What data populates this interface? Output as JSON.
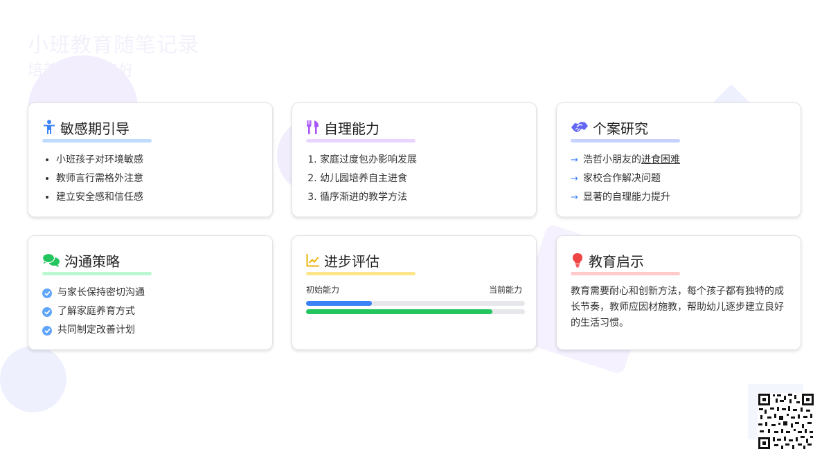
{
  "page": {
    "title": "小班教育随笔记录",
    "subtitle": "培养孩子的良好习惯"
  },
  "cards": [
    {
      "title": "敏感期引导",
      "icon": "child-icon",
      "accent": "#3b82f6",
      "underline": "#bfdbfe",
      "items": [
        "小班孩子对环境敏感",
        "教师言行需格外注意",
        "建立安全感和信任感"
      ]
    },
    {
      "title": "自理能力",
      "icon": "utensils-icon",
      "accent": "#a855f7",
      "underline": "#e9d5ff",
      "items": [
        "家庭过度包办影响发展",
        "幼儿园培养自主进食",
        "循序渐进的教学方法"
      ]
    },
    {
      "title": "个案研究",
      "icon": "handshake-icon",
      "accent": "#6366f1",
      "underline": "#c7d2fe",
      "items": [
        {
          "prefix": "浩哲小朋友的",
          "emphasis": "进食困难"
        },
        "家校合作解决问题",
        "显著的自理能力提升"
      ]
    },
    {
      "title": "沟通策略",
      "icon": "chat-bubbles-icon",
      "accent": "#22c55e",
      "underline": "#bbf7d0",
      "items": [
        "与家长保持密切沟通",
        "了解家庭养育方式",
        "共同制定改善计划"
      ]
    },
    {
      "title": "进步评估",
      "icon": "line-chart-icon",
      "accent": "#eab308",
      "underline": "#fde68a",
      "progress": {
        "start_label": "初始能力",
        "end_label": "当前能力",
        "initial_fraction": 0.3,
        "current_fraction": 0.85,
        "initial_color": "#3b82f6",
        "current_color": "#22c55e"
      }
    },
    {
      "title": "教育启示",
      "icon": "lightbulb-icon",
      "accent": "#ef4444",
      "underline": "#fecaca",
      "text": "教育需要耐心和创新方法，每个孩子都有独特的成长节奏，教师应因材施教，帮助幼儿逐步建立良好的生活习惯。"
    }
  ]
}
